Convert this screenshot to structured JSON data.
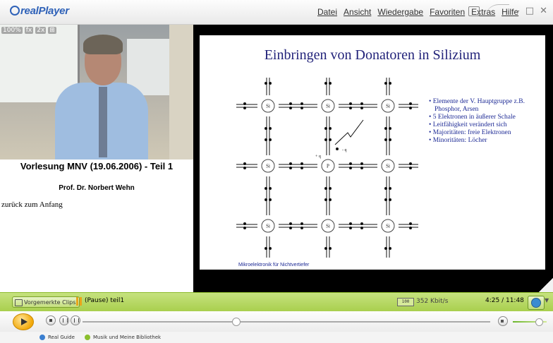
{
  "app": {
    "logo_text": "realPlayer"
  },
  "menu": [
    "Datei",
    "Ansicht",
    "Wiedergabe",
    "Favoriten",
    "Extras",
    "Hilfe"
  ],
  "video": {
    "tags": [
      "100%",
      "fx",
      "2x",
      "⊞"
    ]
  },
  "info": {
    "title": "Vorlesung MNV (19.06.2006) - Teil 1",
    "author": "Prof. Dr. Norbert Wehn",
    "back_link": "zurück zum Anfang"
  },
  "slide": {
    "title": "Einbringen von Donatoren in Silizium",
    "bullets": [
      "Elemente der V. Hauptgruppe z.B. Phosphor, Arsen",
      "5 Elektronen in äußerer Schale",
      "Leitfähigkeit verändert sich",
      "Majoritäten: freie Elektronen",
      "Minoritäten: Löcher"
    ],
    "atom_si": "Si",
    "atom_p": "P",
    "charge_plus": "+ q",
    "charge_minus": "- q",
    "footer": "Mikroelektronik für Nichtvertiefer"
  },
  "status": {
    "clips_button": "Vorgemerkte Clips",
    "status_text": "(Pause) teil1",
    "bandwidth_icon": "100",
    "bitrate": "352 Kbit/s",
    "time": "4:25 / 11:48"
  },
  "transport": {
    "position_fraction": 0.375,
    "volume_fraction": 0.75
  },
  "nav": {
    "guide": "Real Guide",
    "library": "Musik und Meine Bibliothek"
  },
  "colors": {
    "status_green": "#b6d85f",
    "play_orange": "#f2a90a",
    "slide_blue": "#22237a"
  }
}
